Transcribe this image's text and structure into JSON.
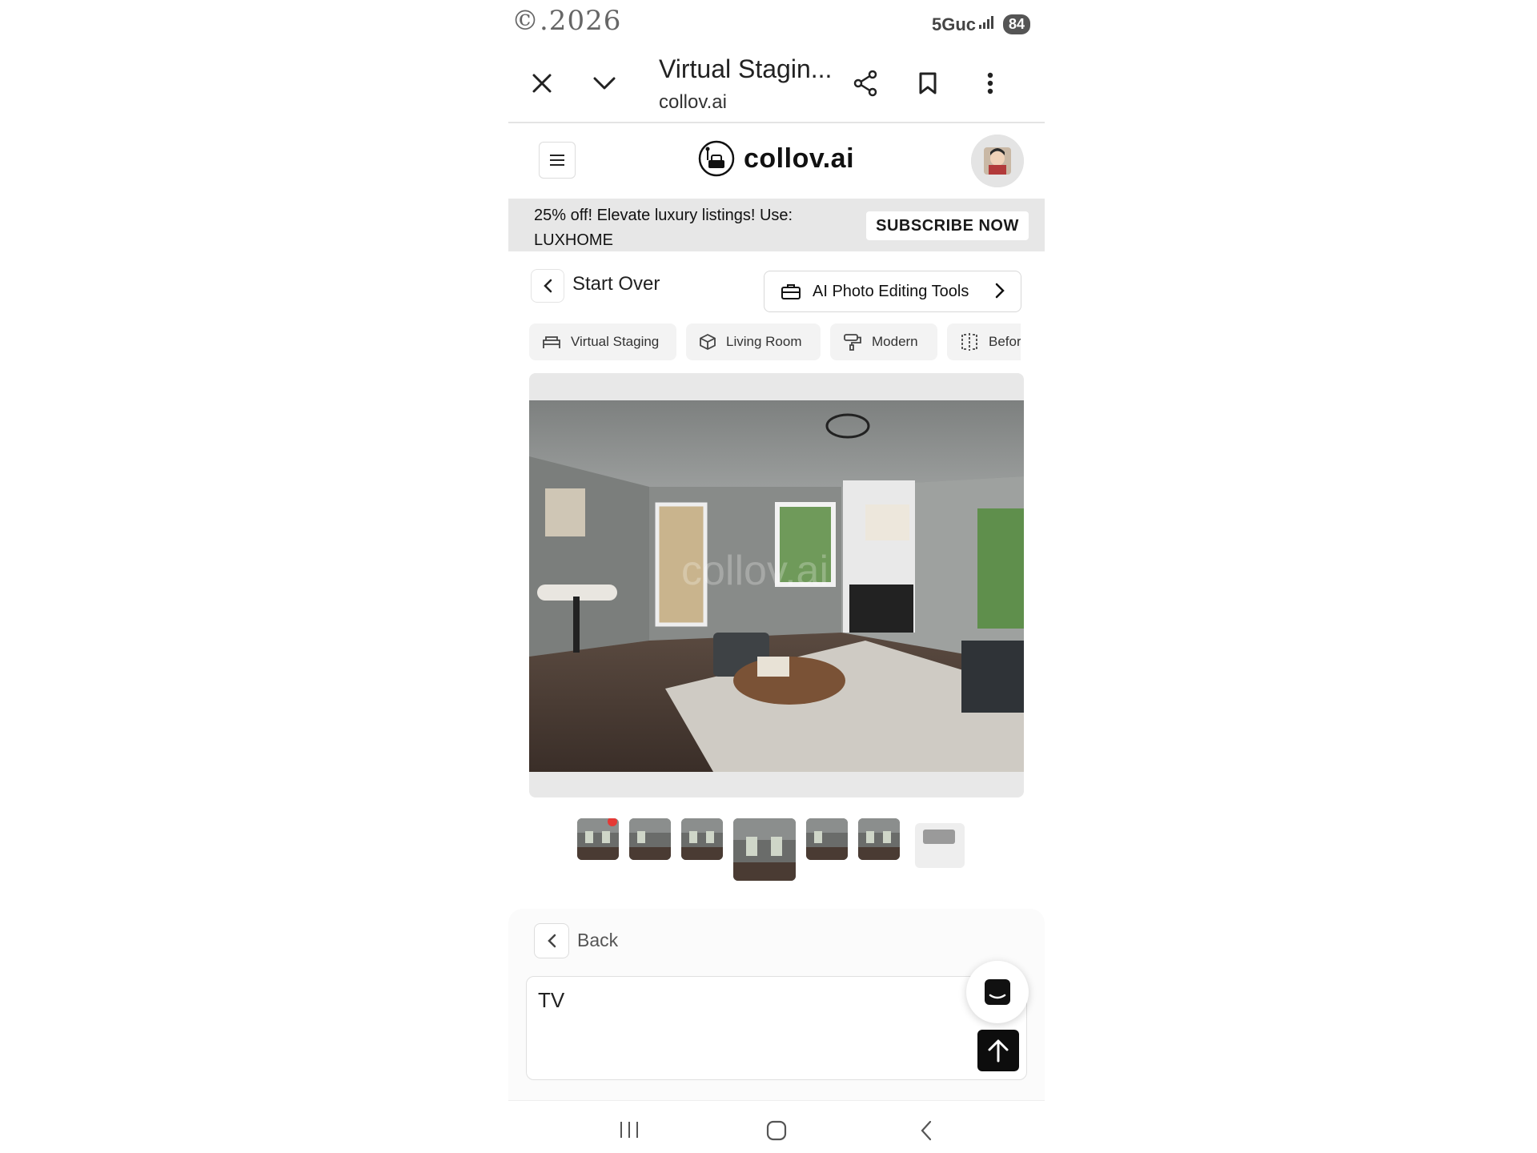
{
  "status_bar": {
    "clock": "©.2026",
    "network": "5Guc",
    "battery": "84"
  },
  "browser": {
    "page_title": "Virtual Stagin...",
    "url": "collov.ai",
    "icons": [
      "close-icon",
      "chevron-down-icon",
      "share-icon",
      "bookmark-icon",
      "more-vertical-icon"
    ]
  },
  "header": {
    "logo_text": "collov.ai"
  },
  "promo": {
    "text": "25% off! Elevate luxury listings! Use: LUXHOME",
    "button": "SUBSCRIBE NOW"
  },
  "nav": {
    "start_over": "Start Over",
    "tools_button": "AI Photo Editing Tools"
  },
  "chips": [
    {
      "label": "Virtual Staging",
      "icon": "bed-icon"
    },
    {
      "label": "Living Room",
      "icon": "cube-icon"
    },
    {
      "label": "Modern",
      "icon": "paint-roller-icon"
    },
    {
      "label": "Befor",
      "icon": "compare-icon"
    }
  ],
  "image": {
    "watermark": "collov.ai"
  },
  "thumbnails": {
    "count": 7,
    "selected_index": 3,
    "notification_on_index": 0
  },
  "panel": {
    "back_label": "Back",
    "prompt_value": "TV"
  }
}
